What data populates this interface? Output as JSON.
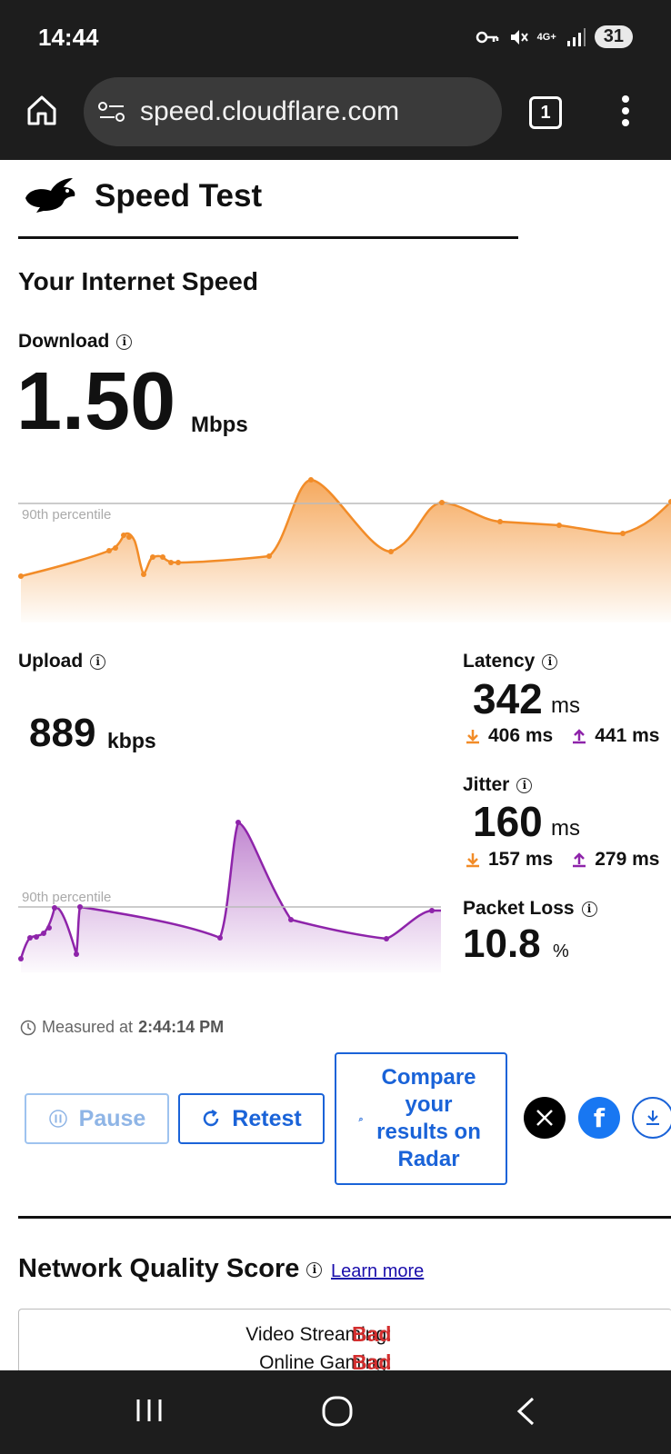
{
  "status": {
    "time": "14:44",
    "network": "4G+",
    "battery": "31"
  },
  "browser": {
    "url": "speed.cloudflare.com",
    "tab_count": "1"
  },
  "header": {
    "title": "Speed Test"
  },
  "speed": {
    "section_title": "Your Internet Speed",
    "download": {
      "label": "Download",
      "value": "1.50",
      "unit": "Mbps"
    },
    "upload": {
      "label": "Upload",
      "value": "889",
      "unit": "kbps"
    },
    "percentile_label": "90th percentile"
  },
  "latency": {
    "label": "Latency",
    "value": "342",
    "unit": "ms",
    "down": "406 ms",
    "up": "441 ms"
  },
  "jitter": {
    "label": "Jitter",
    "value": "160",
    "unit": "ms",
    "down": "157 ms",
    "up": "279 ms"
  },
  "packet_loss": {
    "label": "Packet Loss",
    "value": "10.8",
    "unit": "%"
  },
  "measured": {
    "prefix": "Measured at",
    "time": "2:44:14 PM"
  },
  "actions": {
    "pause": "Pause",
    "retest": "Retest",
    "compare": "Compare your results on Radar"
  },
  "quality": {
    "title": "Network Quality Score",
    "learn_more": "Learn more",
    "rows": [
      {
        "label": "Video Streaming:",
        "value": "Bad"
      },
      {
        "label": "Online Gaming:",
        "value": "Bad"
      }
    ]
  },
  "colors": {
    "download": "#f28c28",
    "upload": "#8e24aa",
    "link": "#1a63d8",
    "bad": "#d32f2f"
  },
  "icons": [
    "home-icon",
    "site-settings-icon",
    "more-vert-icon",
    "rabbit-logo-icon",
    "info-icon",
    "clock-icon",
    "download-arrow-icon",
    "upload-arrow-icon",
    "pause-icon",
    "refresh-icon",
    "x-logo-icon",
    "facebook-icon",
    "download-icon",
    "recents-icon",
    "home-nav-icon",
    "back-icon"
  ]
}
